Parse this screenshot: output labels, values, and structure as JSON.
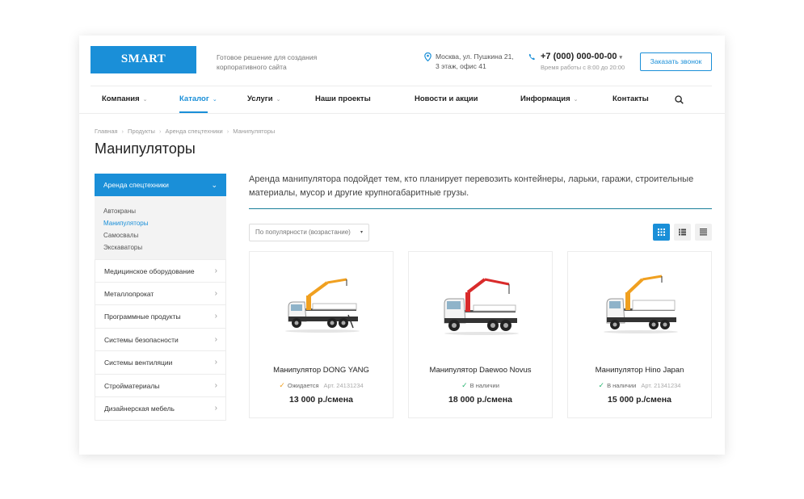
{
  "header": {
    "logo": "SMART",
    "tagline": "Готовое решение для создания корпоративного сайта",
    "address_line1": "Москва, ул. Пушкина 21,",
    "address_line2": "3 этаж, офис 41",
    "phone": "+7 (000) 000-00-00",
    "phone_caret": "▾",
    "hours": "Время работы с 8:00 до 20:00",
    "callback_label": "Заказать звонок"
  },
  "nav": {
    "items": [
      {
        "label": "Компания",
        "chev": "⌄"
      },
      {
        "label": "Каталог",
        "chev": "⌄"
      },
      {
        "label": "Услуги",
        "chev": "⌄"
      },
      {
        "label": "Наши проекты",
        "chev": ""
      },
      {
        "label": "Новости и акции",
        "chev": ""
      },
      {
        "label": "Информация",
        "chev": "⌄"
      },
      {
        "label": "Контакты",
        "chev": ""
      }
    ]
  },
  "breadcrumb": [
    "Главная",
    "Продукты",
    "Аренда спецтехники",
    "Манипуляторы"
  ],
  "breadcrumb_sep": "›",
  "page_title": "Манипуляторы",
  "sidebar": {
    "head": "Аренда спецтехники",
    "head_chev": "⌄",
    "subitems": [
      "Автокраны",
      "Манипуляторы",
      "Самосвалы",
      "Экскаваторы"
    ],
    "items": [
      "Медицинское оборудование",
      "Металлопрокат",
      "Программные продукты",
      "Системы безопасности",
      "Системы вентиляции",
      "Стройматериалы",
      "Дизайнерская мебель"
    ],
    "item_chev": "›"
  },
  "intro": "Аренда манипулятора подойдет тем, кто планирует перевозить контейнеры, ларьки, гаражи, строительные материалы, мусор и другие крупногабаритные грузы.",
  "sort": {
    "value": "По популярности (возрастание)",
    "caret": "▾"
  },
  "products": [
    {
      "name": "Манипулятор DONG YANG",
      "status": "Ожидается",
      "status_color": "#f0a020",
      "article": "Арт. 24131234",
      "price": "13 000 р./смена",
      "check": "✓",
      "boom_color": "#f0a020"
    },
    {
      "name": "Манипулятор Daewoo Novus",
      "status": "В наличии",
      "status_color": "#2bb673",
      "article": "",
      "price": "18 000 р./смена",
      "check": "✓",
      "boom_color": "#d92b2b"
    },
    {
      "name": "Манипулятор Hino Japan",
      "status": "В наличии",
      "status_color": "#2bb673",
      "article": "Арт. 21341234",
      "price": "15 000 р./смена",
      "check": "✓",
      "boom_color": "#f0a020"
    }
  ],
  "colors": {
    "accent": "#1a8fd8",
    "intro_line": "#1a7f9a"
  }
}
